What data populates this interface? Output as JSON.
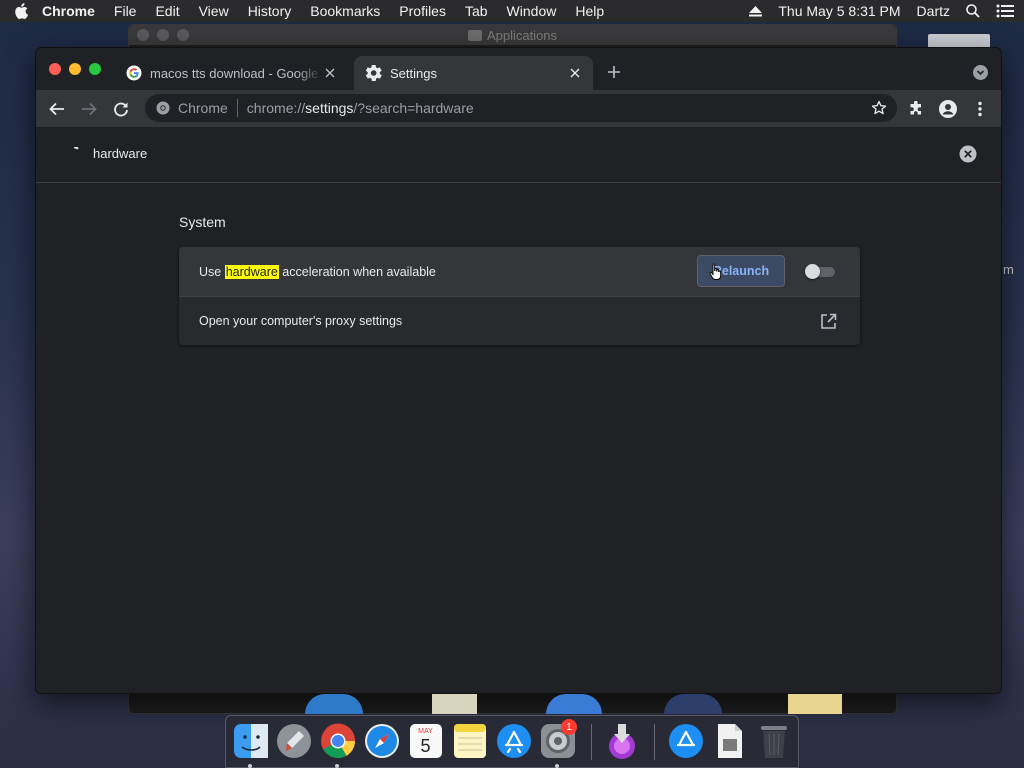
{
  "menubar": {
    "app": "Chrome",
    "menus": [
      "File",
      "Edit",
      "View",
      "History",
      "Bookmarks",
      "Profiles",
      "Tab",
      "Window",
      "Help"
    ],
    "datetime": "Thu May 5  8:31 PM",
    "user": "Dartz",
    "icons": [
      "apple-icon",
      "eject-icon",
      "spotlight-icon",
      "notification-center-icon"
    ]
  },
  "background": {
    "finder_window_title": "Applications",
    "partial_text": "m"
  },
  "tabs": [
    {
      "title": "macos tts download - Google S",
      "icon": "google-icon",
      "active": false
    },
    {
      "title": "Settings",
      "icon": "gear-icon",
      "active": true
    }
  ],
  "omnibox": {
    "chip": "Chrome",
    "url_scheme": "chrome://",
    "url_host": "settings",
    "url_path": "/?search=hardware"
  },
  "settings_search": {
    "query": "hardware"
  },
  "settings": {
    "section_title": "System",
    "hardware_row": {
      "prefix": "Use ",
      "highlight": "hardware",
      "suffix": " acceleration when available",
      "relaunch_label": "Relaunch",
      "toggle_on": false
    },
    "proxy_row": {
      "label": "Open your computer's proxy settings"
    }
  },
  "dock": {
    "items": [
      "Finder",
      "Launchpad",
      "Google Chrome",
      "Safari",
      "Calendar",
      "Notes",
      "App Store",
      "System Preferences",
      "Downloads Installer",
      "App Store Folder",
      "Document",
      "Trash"
    ],
    "calendar_month": "MAY",
    "calendar_day": "5",
    "system_preferences_badge": "1"
  },
  "colors": {
    "highlight": "#ffff00",
    "accent_link": "#8ab4f8",
    "chrome_bg": "#202124",
    "toolbar_bg": "#35363a"
  }
}
